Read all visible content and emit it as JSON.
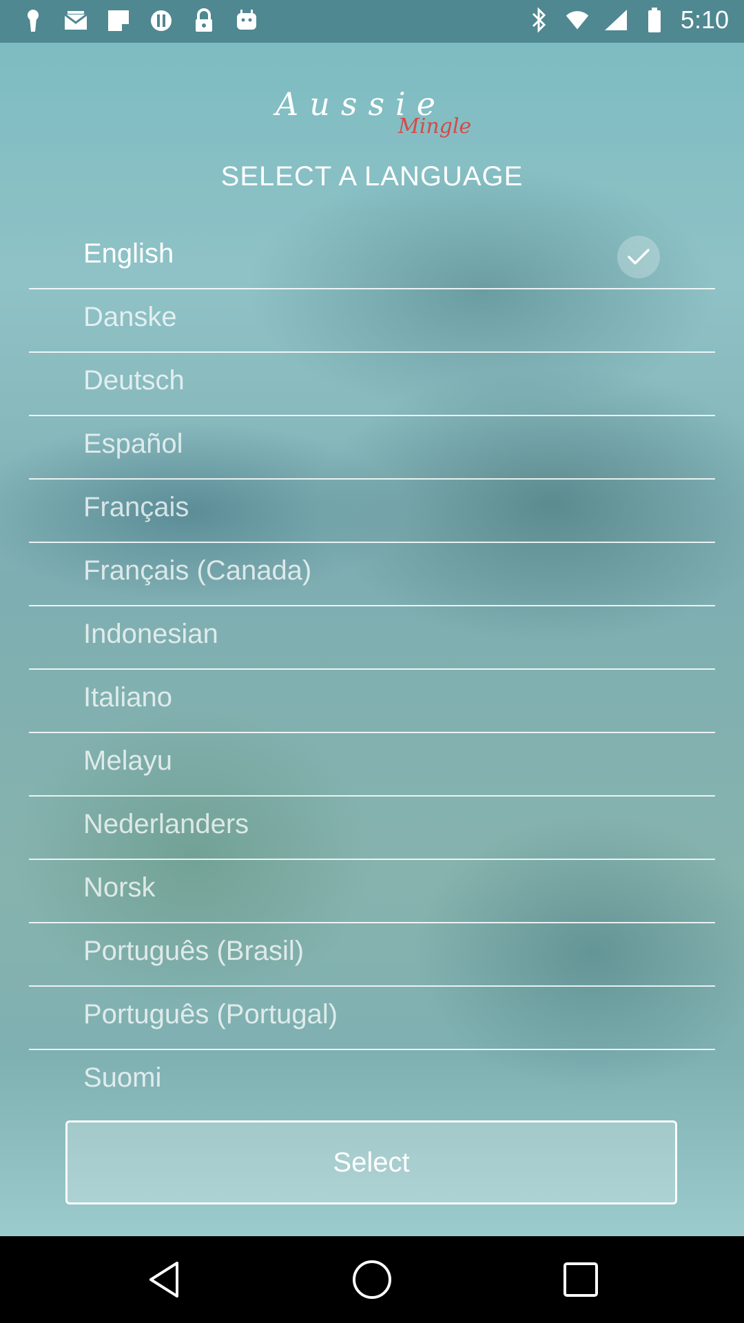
{
  "status_bar": {
    "time": "5:10",
    "left_icons": [
      "keyhole-icon",
      "mail-icon",
      "flipboard-icon",
      "alert-icon",
      "lock-icon",
      "android-icon"
    ],
    "right_icons": [
      "bluetooth-icon",
      "wifi-icon",
      "signal-icon",
      "battery-icon"
    ]
  },
  "logo": {
    "main": "Aussie",
    "sub": "Mingle"
  },
  "heading": "SELECT A LANGUAGE",
  "languages": [
    {
      "label": "English",
      "selected": true
    },
    {
      "label": "Danske",
      "selected": false
    },
    {
      "label": "Deutsch",
      "selected": false
    },
    {
      "label": "Español",
      "selected": false
    },
    {
      "label": "Français",
      "selected": false
    },
    {
      "label": "Français (Canada)",
      "selected": false
    },
    {
      "label": "Indonesian",
      "selected": false
    },
    {
      "label": "Italiano",
      "selected": false
    },
    {
      "label": "Melayu",
      "selected": false
    },
    {
      "label": "Nederlanders",
      "selected": false
    },
    {
      "label": "Norsk",
      "selected": false
    },
    {
      "label": "Português (Brasil)",
      "selected": false
    },
    {
      "label": "Português (Portugal)",
      "selected": false
    },
    {
      "label": "Suomi",
      "selected": false
    }
  ],
  "select_button": "Select",
  "nav": {
    "back": "back-icon",
    "home": "home-icon",
    "recents": "recents-icon"
  },
  "colors": {
    "status_bar": "#4f8890",
    "logo_accent": "#d44a4a",
    "text": "#ffffff"
  }
}
